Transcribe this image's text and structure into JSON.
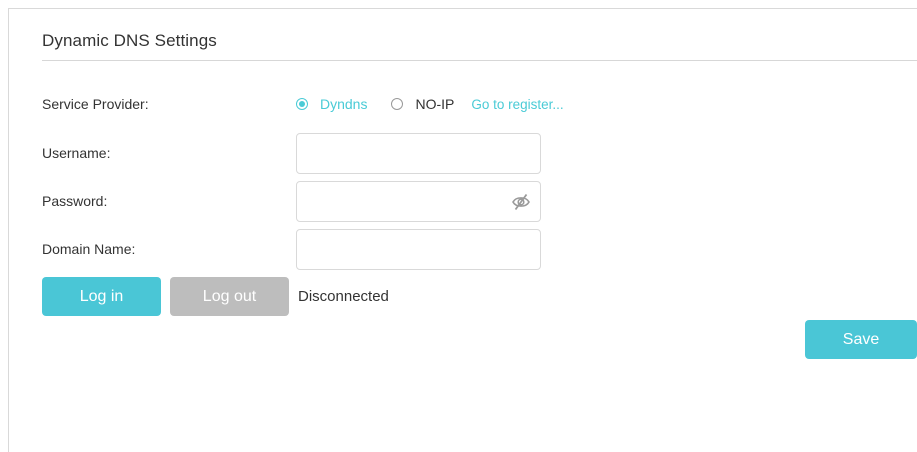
{
  "title": "Dynamic DNS Settings",
  "service_provider": {
    "label": "Service Provider:",
    "options": [
      {
        "label": "Dyndns",
        "selected": true
      },
      {
        "label": "NO-IP",
        "selected": false
      }
    ],
    "register_link": "Go to register..."
  },
  "username": {
    "label": "Username:",
    "value": ""
  },
  "password": {
    "label": "Password:",
    "value": "",
    "icon": "eye-off-icon"
  },
  "domain_name": {
    "label": "Domain Name:",
    "value": ""
  },
  "buttons": {
    "login": "Log in",
    "logout": "Log out",
    "save": "Save"
  },
  "status": "Disconnected",
  "colors": {
    "accent": "#4ac6d6",
    "disabled": "#bdbdbd",
    "text": "#333333",
    "border": "#d9d9d9"
  }
}
